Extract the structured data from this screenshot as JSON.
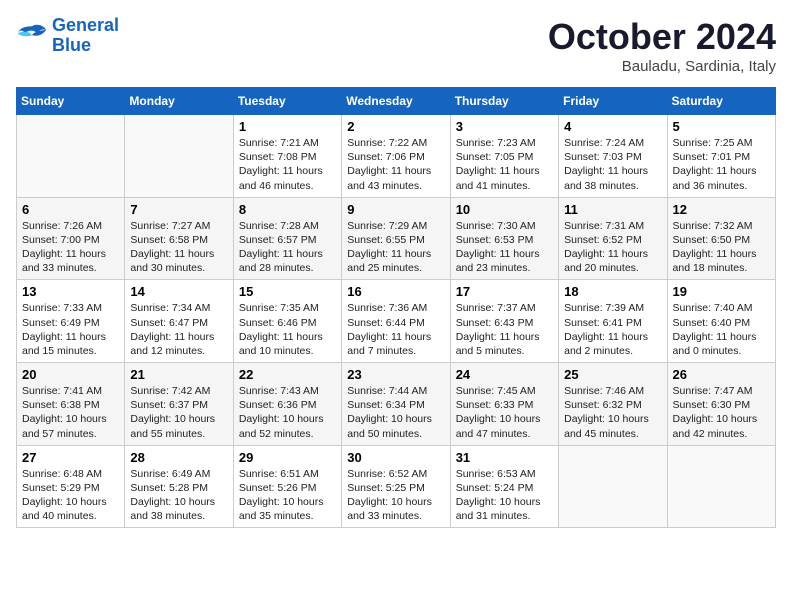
{
  "header": {
    "logo_line1": "General",
    "logo_line2": "Blue",
    "month": "October 2024",
    "location": "Bauladu, Sardinia, Italy"
  },
  "weekdays": [
    "Sunday",
    "Monday",
    "Tuesday",
    "Wednesday",
    "Thursday",
    "Friday",
    "Saturday"
  ],
  "weeks": [
    [
      {
        "day": "",
        "text": ""
      },
      {
        "day": "",
        "text": ""
      },
      {
        "day": "1",
        "text": "Sunrise: 7:21 AM\nSunset: 7:08 PM\nDaylight: 11 hours\nand 46 minutes."
      },
      {
        "day": "2",
        "text": "Sunrise: 7:22 AM\nSunset: 7:06 PM\nDaylight: 11 hours\nand 43 minutes."
      },
      {
        "day": "3",
        "text": "Sunrise: 7:23 AM\nSunset: 7:05 PM\nDaylight: 11 hours\nand 41 minutes."
      },
      {
        "day": "4",
        "text": "Sunrise: 7:24 AM\nSunset: 7:03 PM\nDaylight: 11 hours\nand 38 minutes."
      },
      {
        "day": "5",
        "text": "Sunrise: 7:25 AM\nSunset: 7:01 PM\nDaylight: 11 hours\nand 36 minutes."
      }
    ],
    [
      {
        "day": "6",
        "text": "Sunrise: 7:26 AM\nSunset: 7:00 PM\nDaylight: 11 hours\nand 33 minutes."
      },
      {
        "day": "7",
        "text": "Sunrise: 7:27 AM\nSunset: 6:58 PM\nDaylight: 11 hours\nand 30 minutes."
      },
      {
        "day": "8",
        "text": "Sunrise: 7:28 AM\nSunset: 6:57 PM\nDaylight: 11 hours\nand 28 minutes."
      },
      {
        "day": "9",
        "text": "Sunrise: 7:29 AM\nSunset: 6:55 PM\nDaylight: 11 hours\nand 25 minutes."
      },
      {
        "day": "10",
        "text": "Sunrise: 7:30 AM\nSunset: 6:53 PM\nDaylight: 11 hours\nand 23 minutes."
      },
      {
        "day": "11",
        "text": "Sunrise: 7:31 AM\nSunset: 6:52 PM\nDaylight: 11 hours\nand 20 minutes."
      },
      {
        "day": "12",
        "text": "Sunrise: 7:32 AM\nSunset: 6:50 PM\nDaylight: 11 hours\nand 18 minutes."
      }
    ],
    [
      {
        "day": "13",
        "text": "Sunrise: 7:33 AM\nSunset: 6:49 PM\nDaylight: 11 hours\nand 15 minutes."
      },
      {
        "day": "14",
        "text": "Sunrise: 7:34 AM\nSunset: 6:47 PM\nDaylight: 11 hours\nand 12 minutes."
      },
      {
        "day": "15",
        "text": "Sunrise: 7:35 AM\nSunset: 6:46 PM\nDaylight: 11 hours\nand 10 minutes."
      },
      {
        "day": "16",
        "text": "Sunrise: 7:36 AM\nSunset: 6:44 PM\nDaylight: 11 hours\nand 7 minutes."
      },
      {
        "day": "17",
        "text": "Sunrise: 7:37 AM\nSunset: 6:43 PM\nDaylight: 11 hours\nand 5 minutes."
      },
      {
        "day": "18",
        "text": "Sunrise: 7:39 AM\nSunset: 6:41 PM\nDaylight: 11 hours\nand 2 minutes."
      },
      {
        "day": "19",
        "text": "Sunrise: 7:40 AM\nSunset: 6:40 PM\nDaylight: 11 hours\nand 0 minutes."
      }
    ],
    [
      {
        "day": "20",
        "text": "Sunrise: 7:41 AM\nSunset: 6:38 PM\nDaylight: 10 hours\nand 57 minutes."
      },
      {
        "day": "21",
        "text": "Sunrise: 7:42 AM\nSunset: 6:37 PM\nDaylight: 10 hours\nand 55 minutes."
      },
      {
        "day": "22",
        "text": "Sunrise: 7:43 AM\nSunset: 6:36 PM\nDaylight: 10 hours\nand 52 minutes."
      },
      {
        "day": "23",
        "text": "Sunrise: 7:44 AM\nSunset: 6:34 PM\nDaylight: 10 hours\nand 50 minutes."
      },
      {
        "day": "24",
        "text": "Sunrise: 7:45 AM\nSunset: 6:33 PM\nDaylight: 10 hours\nand 47 minutes."
      },
      {
        "day": "25",
        "text": "Sunrise: 7:46 AM\nSunset: 6:32 PM\nDaylight: 10 hours\nand 45 minutes."
      },
      {
        "day": "26",
        "text": "Sunrise: 7:47 AM\nSunset: 6:30 PM\nDaylight: 10 hours\nand 42 minutes."
      }
    ],
    [
      {
        "day": "27",
        "text": "Sunrise: 6:48 AM\nSunset: 5:29 PM\nDaylight: 10 hours\nand 40 minutes."
      },
      {
        "day": "28",
        "text": "Sunrise: 6:49 AM\nSunset: 5:28 PM\nDaylight: 10 hours\nand 38 minutes."
      },
      {
        "day": "29",
        "text": "Sunrise: 6:51 AM\nSunset: 5:26 PM\nDaylight: 10 hours\nand 35 minutes."
      },
      {
        "day": "30",
        "text": "Sunrise: 6:52 AM\nSunset: 5:25 PM\nDaylight: 10 hours\nand 33 minutes."
      },
      {
        "day": "31",
        "text": "Sunrise: 6:53 AM\nSunset: 5:24 PM\nDaylight: 10 hours\nand 31 minutes."
      },
      {
        "day": "",
        "text": ""
      },
      {
        "day": "",
        "text": ""
      }
    ]
  ]
}
